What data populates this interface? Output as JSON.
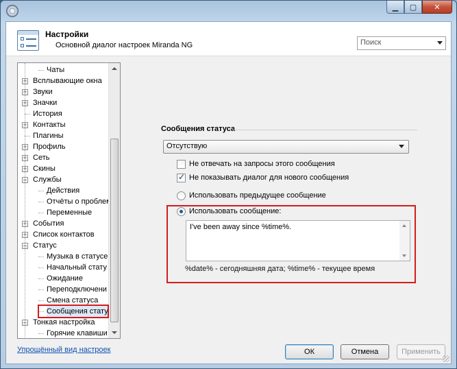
{
  "window": {
    "header_title": "Настройки",
    "header_subtitle": "Основной диалог настроек Miranda NG",
    "search_placeholder": "Поиск",
    "min_glyph": "▁",
    "max_glyph": "▢",
    "close_glyph": "✕"
  },
  "tree": {
    "items": [
      {
        "label": "Чаты",
        "expander": ""
      },
      {
        "label": "Всплывающие окна",
        "expander": "+"
      },
      {
        "label": "Звуки",
        "expander": "+"
      },
      {
        "label": "Значки",
        "expander": "+"
      },
      {
        "label": "История",
        "expander": ""
      },
      {
        "label": "Контакты",
        "expander": "+"
      },
      {
        "label": "Плагины",
        "expander": ""
      },
      {
        "label": "Профиль",
        "expander": "+"
      },
      {
        "label": "Сеть",
        "expander": "+"
      },
      {
        "label": "Скины",
        "expander": "+"
      },
      {
        "label": "Службы",
        "expander": "−"
      },
      {
        "label": "Действия",
        "expander": ""
      },
      {
        "label": "Отчёты о проблем",
        "expander": ""
      },
      {
        "label": "Переменные",
        "expander": ""
      },
      {
        "label": "События",
        "expander": "+"
      },
      {
        "label": "Список контактов",
        "expander": "+"
      },
      {
        "label": "Статус",
        "expander": "−"
      },
      {
        "label": "Музыка в статусе",
        "expander": ""
      },
      {
        "label": "Начальный стату",
        "expander": ""
      },
      {
        "label": "Ожидание",
        "expander": ""
      },
      {
        "label": "Переподключени",
        "expander": ""
      },
      {
        "label": "Смена статуса",
        "expander": ""
      },
      {
        "label": "Сообщения стату",
        "expander": ""
      },
      {
        "label": "Тонкая настройка",
        "expander": "−"
      },
      {
        "label": "Горячие клавиши",
        "expander": ""
      }
    ],
    "selected": "Сообщения стату"
  },
  "status_messages": {
    "group_title": "Сообщения статуса",
    "status_combo_value": "Отсутствую",
    "chk_no_reply": {
      "label": "Не отвечать на запросы этого сообщения",
      "checked": false
    },
    "chk_no_dialog": {
      "label": "Не показывать диалог для нового сообщения",
      "checked": true
    },
    "radio_previous": {
      "label": "Использовать предыдущее сообщение",
      "selected": false
    },
    "radio_custom": {
      "label": "Использовать сообщение:",
      "selected": true
    },
    "message_text": "I've been away since %time%.",
    "hint": "%date% - сегодняшняя дата; %time% - текущее время"
  },
  "footer": {
    "simple_view_link": "Упрощённый вид настроек",
    "ok_label": "ОК",
    "cancel_label": "Отмена",
    "apply_label": "Применить"
  },
  "colors": {
    "highlight_frame": "#d21c1c",
    "link": "#0f4fb0"
  }
}
